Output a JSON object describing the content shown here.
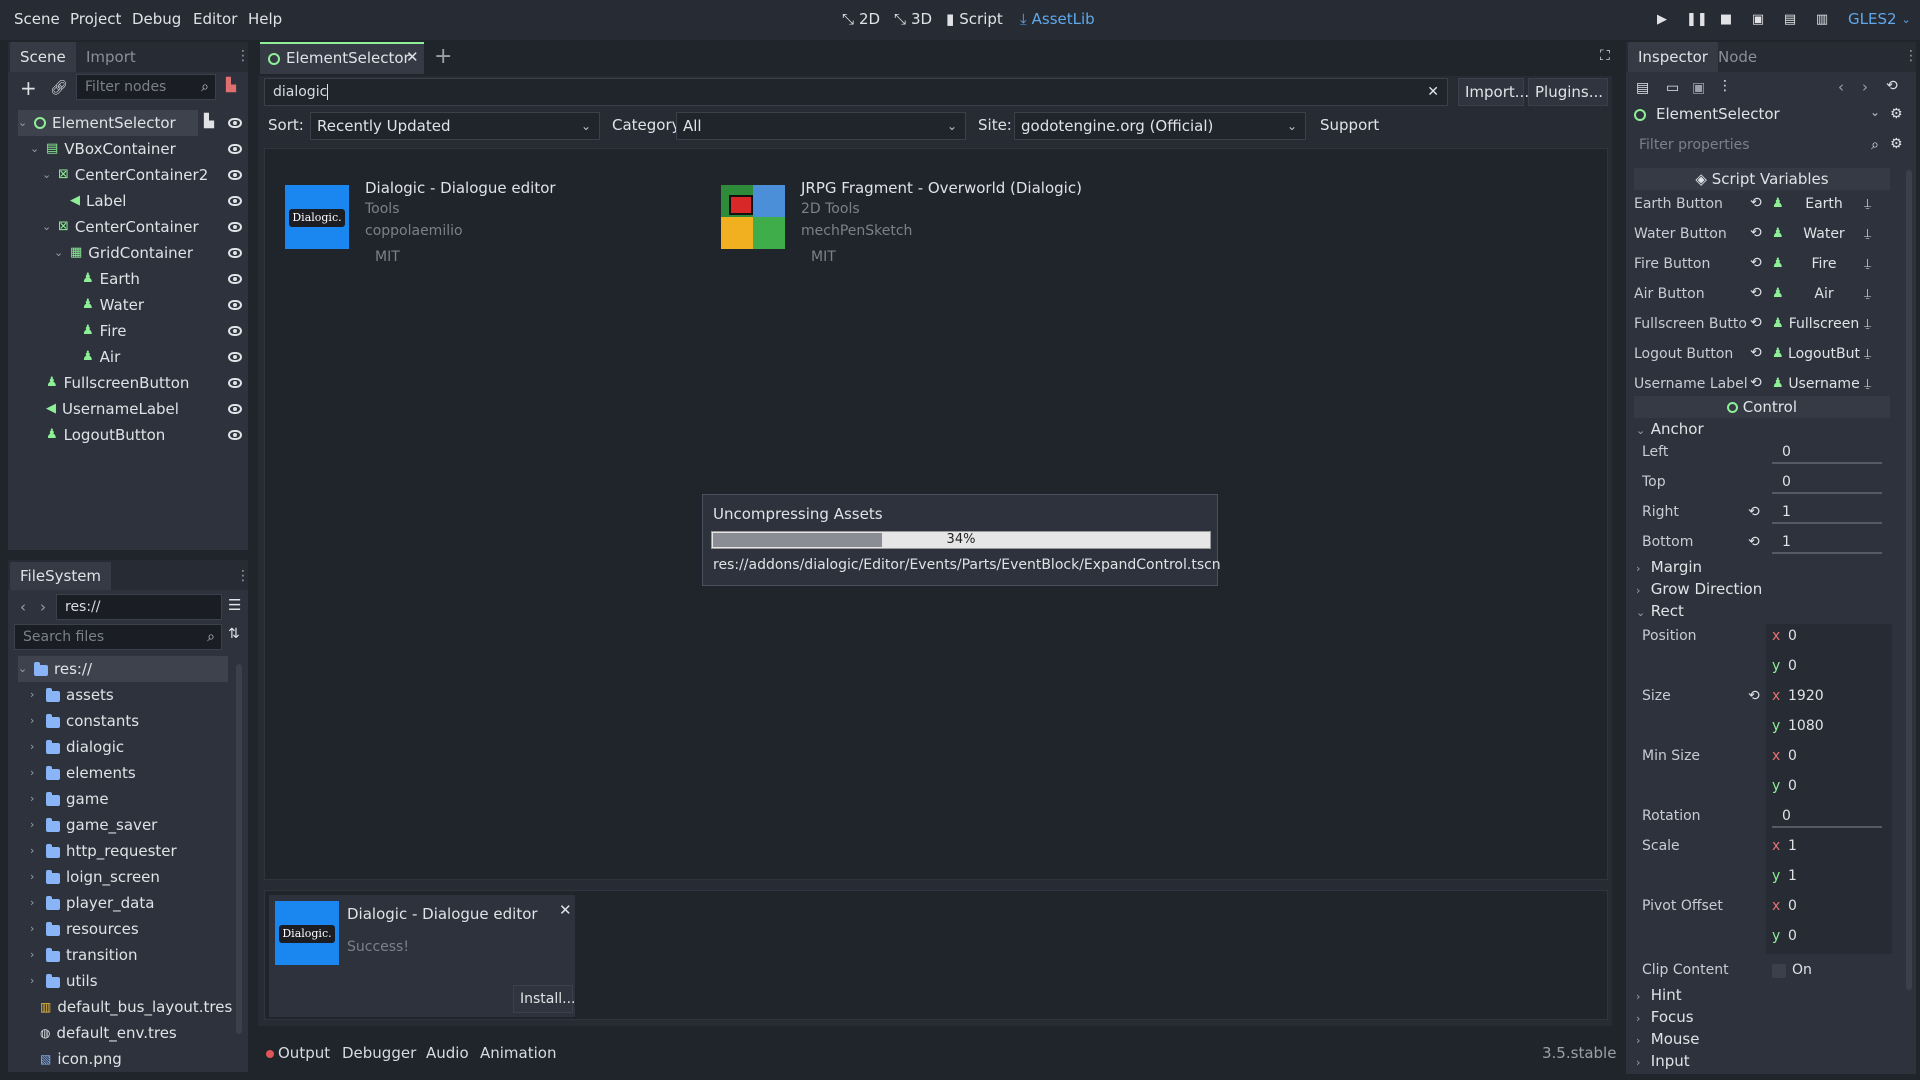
{
  "menubar": {
    "items": [
      "Scene",
      "Project",
      "Debug",
      "Editor",
      "Help"
    ],
    "modes": [
      "2D",
      "3D",
      "Script",
      "AssetLib"
    ],
    "active_mode": "AssetLib",
    "renderer": "GLES2"
  },
  "scene_panel": {
    "tabs": [
      "Scene",
      "Import"
    ],
    "filter_placeholder": "Filter nodes",
    "nodes": [
      {
        "label": "ElementSelector",
        "depth": 0,
        "icon": "control-circle-icon"
      },
      {
        "label": "VBoxContainer",
        "depth": 1,
        "icon": "vbox-icon"
      },
      {
        "label": "CenterContainer2",
        "depth": 2,
        "icon": "center-container-icon"
      },
      {
        "label": "Label",
        "depth": 3,
        "icon": "label-icon"
      },
      {
        "label": "CenterContainer",
        "depth": 2,
        "icon": "center-container-icon"
      },
      {
        "label": "GridContainer",
        "depth": 3,
        "icon": "grid-icon"
      },
      {
        "label": "Earth",
        "depth": 4,
        "icon": "button-icon"
      },
      {
        "label": "Water",
        "depth": 4,
        "icon": "button-icon"
      },
      {
        "label": "Fire",
        "depth": 4,
        "icon": "button-icon"
      },
      {
        "label": "Air",
        "depth": 4,
        "icon": "button-icon"
      },
      {
        "label": "FullscreenButton",
        "depth": 1,
        "icon": "button-icon"
      },
      {
        "label": "UsernameLabel",
        "depth": 1,
        "icon": "label-icon"
      },
      {
        "label": "LogoutButton",
        "depth": 1,
        "icon": "button-icon"
      }
    ]
  },
  "filesystem": {
    "title": "FileSystem",
    "path": "res://",
    "search_placeholder": "Search files",
    "items": [
      {
        "label": "res://",
        "type": "root"
      },
      {
        "label": "assets",
        "type": "folder"
      },
      {
        "label": "constants",
        "type": "folder"
      },
      {
        "label": "dialogic",
        "type": "folder"
      },
      {
        "label": "elements",
        "type": "folder"
      },
      {
        "label": "game",
        "type": "folder"
      },
      {
        "label": "game_saver",
        "type": "folder"
      },
      {
        "label": "http_requester",
        "type": "folder"
      },
      {
        "label": "loign_screen",
        "type": "folder"
      },
      {
        "label": "player_data",
        "type": "folder"
      },
      {
        "label": "resources",
        "type": "folder"
      },
      {
        "label": "transition",
        "type": "folder"
      },
      {
        "label": "utils",
        "type": "folder"
      },
      {
        "label": "default_bus_layout.tres",
        "type": "bus"
      },
      {
        "label": "default_env.tres",
        "type": "env"
      },
      {
        "label": "icon.png",
        "type": "image"
      }
    ]
  },
  "editor_tab": {
    "label": "ElementSelector"
  },
  "assetlib": {
    "search_value": "dialogic",
    "import_label": "Import...",
    "plugins_label": "Plugins...",
    "sort_label": "Sort:",
    "sort_value": "Recently Updated",
    "category_label": "Category:",
    "category_value": "All",
    "site_label": "Site:",
    "site_value": "godotengine.org (Official)",
    "support_label": "Support",
    "results": [
      {
        "title": "Dialogic - Dialogue editor",
        "category": "Tools",
        "author": "coppolaemilio",
        "license": "MIT",
        "thumb_text": "Dialogic."
      },
      {
        "title": "JRPG Fragment - Overworld (Dialogic)",
        "category": "2D Tools",
        "author": "mechPenSketch",
        "license": "MIT"
      }
    ]
  },
  "progress_dialog": {
    "title": "Uncompressing Assets",
    "percent_label": "34%",
    "progress": 0.34,
    "file": "res://addons/dialogic/Editor/Events/Parts/EventBlock/ExpandControl.tscn"
  },
  "download": {
    "title": "Dialogic - Dialogue editor",
    "status": "Success!",
    "install_label": "Install...",
    "thumb_text": "Dialogic."
  },
  "bottom_bar": {
    "tabs": [
      "Output",
      "Debugger",
      "Audio",
      "Animation"
    ],
    "version": "3.5.stable"
  },
  "inspector": {
    "tabs": [
      "Inspector",
      "Node"
    ],
    "object": "ElementSelector",
    "filter_placeholder": "Filter properties",
    "script_section": "Script Variables",
    "script_vars": [
      {
        "name": "Earth Button",
        "value": "Earth"
      },
      {
        "name": "Water Button",
        "value": "Water"
      },
      {
        "name": "Fire Button",
        "value": "Fire"
      },
      {
        "name": "Air Button",
        "value": "Air"
      },
      {
        "name": "Fullscreen Butto",
        "value": "Fullscreen"
      },
      {
        "name": "Logout Button",
        "value": "LogoutBut"
      },
      {
        "name": "Username Label",
        "value": "Username"
      }
    ],
    "control_section": "Control",
    "anchor": {
      "title": "Anchor",
      "left_label": "Left",
      "left": "0",
      "top_label": "Top",
      "top": "0",
      "right_label": "Right",
      "right": "1",
      "bottom_label": "Bottom",
      "bottom": "1"
    },
    "margin": "Margin",
    "grow_direction": "Grow Direction",
    "rect": {
      "title": "Rect",
      "position_label": "Position",
      "position_x": "0",
      "position_y": "0",
      "size_label": "Size",
      "size_x": "1920",
      "size_y": "1080",
      "min_size_label": "Min Size",
      "min_x": "0",
      "min_y": "0",
      "rotation_label": "Rotation",
      "rotation": "0",
      "scale_label": "Scale",
      "scale_x": "1",
      "scale_y": "1",
      "pivot_label": "Pivot Offset",
      "pivot_x": "0",
      "pivot_y": "0",
      "clip_label": "Clip Content",
      "clip_value": "On"
    },
    "collapsed": [
      "Hint",
      "Focus",
      "Mouse",
      "Input"
    ]
  },
  "colors": {
    "accent": "#5fa8ec",
    "node_green": "#8eef97",
    "folder_blue": "#8ab4f8",
    "dialogic_blue": "#1a86f0"
  }
}
